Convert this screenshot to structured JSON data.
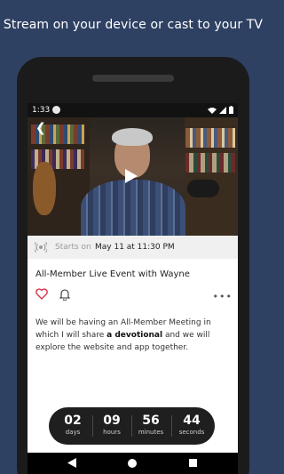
{
  "headline": "Stream on your device or cast to your TV",
  "status_bar": {
    "time": "1:33",
    "icons": [
      "app-notification-icon",
      "wifi-icon",
      "signal-icon",
      "battery-icon"
    ]
  },
  "video": {
    "back_icon": "chevron-left-icon",
    "play_icon": "play-icon"
  },
  "event": {
    "starts_label": "Starts on",
    "starts_date": "May 11 at 11:30 PM",
    "title": "All-Member Live Event with Wayne",
    "description_part1": "We will be having an All-Member Meeting in which I will share ",
    "description_bold": "a devotional",
    "description_part2": " and we will explore the website and app together."
  },
  "countdown": {
    "days": "02",
    "days_label": "days",
    "hours": "09",
    "hours_label": "hours",
    "minutes": "56",
    "minutes_label": "minutes",
    "seconds": "44",
    "seconds_label": "seconds"
  },
  "colors": {
    "background": "#2f4163",
    "heart": "#d9304a",
    "countdown_bg": "#1f1f1f"
  }
}
